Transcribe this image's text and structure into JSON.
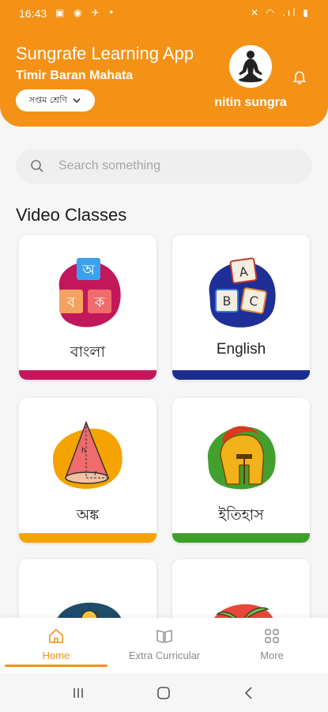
{
  "status_bar": {
    "time": "16:43",
    "left_icons": "▣ ◉ ✈ •",
    "right_icons": "✕ ◠ .ıl ▮"
  },
  "header": {
    "app_title": "Sungrafe Learning App",
    "user_full_name": "Timir Baran Mahata",
    "class_selector": "সপ্তম শ্রেণি",
    "username": "nitin sungra",
    "accent_color": "#f39217"
  },
  "search": {
    "placeholder": "Search something"
  },
  "section": {
    "title": "Video Classes"
  },
  "cards": [
    {
      "label": "বাংলা",
      "bar_color": "#c4165a"
    },
    {
      "label": "English",
      "bar_color": "#1b2d8f"
    },
    {
      "label": "অঙ্ক",
      "bar_color": "#f5a300"
    },
    {
      "label": "ইতিহাস",
      "bar_color": "#3f9f2b"
    }
  ],
  "bottom_nav": [
    {
      "label": "Home",
      "icon": "home-icon",
      "active": true
    },
    {
      "label": "Extra Curricular",
      "icon": "book-icon",
      "active": false
    },
    {
      "label": "More",
      "icon": "grid-icon",
      "active": false
    }
  ]
}
